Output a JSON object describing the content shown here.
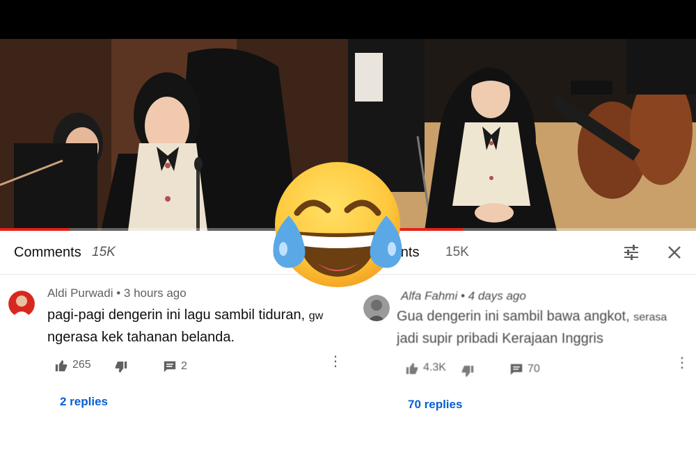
{
  "left": {
    "header": {
      "title": "Comments",
      "count": "15K"
    },
    "comment": {
      "author": "Aldi Purwadi",
      "separator": "•",
      "time": "3 hours ago",
      "line1_main": "pagi-pagi dengerin ini lagu sambil tiduran,",
      "line1_tail": "gw",
      "line2": "ngerasa kek tahanan belanda.",
      "likes": "265",
      "comment_count": "2",
      "replies": "2 replies"
    },
    "progress_fraction": 0.2
  },
  "right": {
    "header": {
      "title": "ments",
      "count": "15K"
    },
    "comment": {
      "author": "Alfa Fahmi",
      "separator": "•",
      "time": "4 days ago",
      "line1_main": "Gua dengerin ini sambil bawa angkot,",
      "line1_tail": "serasa",
      "line2": "jadi supir pribadi Kerajaan Inggris",
      "likes": "4.3K",
      "comment_count": "70",
      "replies": "70 replies"
    },
    "progress_fraction": 0.33
  },
  "icons": {
    "filter": "tune-icon",
    "close": "close-icon",
    "like": "thumb-up-icon",
    "dislike": "thumb-down-icon",
    "comment": "comment-icon",
    "more": "more-vert-icon",
    "emoji": "face-with-tears-of-joy-emoji"
  },
  "colors": {
    "accent_link": "#065fd4",
    "progress_red": "#e62117",
    "emoji_yellow": "#ffc83d"
  }
}
